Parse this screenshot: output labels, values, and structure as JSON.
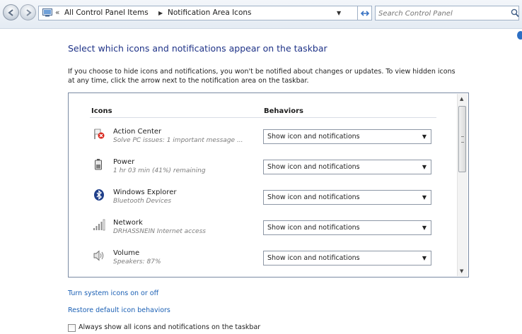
{
  "address_bar": {
    "breadcrumbs": [
      "All Control Panel Items",
      "Notification Area Icons"
    ],
    "search_placeholder": "Search Control Panel"
  },
  "page": {
    "heading": "Select which icons and notifications appear on the taskbar",
    "description": "If you choose to hide icons and notifications, you won't be notified about changes or updates. To view hidden icons at any time, click the arrow next to the notification area on the taskbar."
  },
  "table": {
    "col_icons": "Icons",
    "col_behaviors": "Behaviors",
    "rows": [
      {
        "name": "Action Center",
        "sub": "Solve PC issues: 1 important message ...",
        "behavior": "Show icon and notifications",
        "icon": "action-center-flag-icon"
      },
      {
        "name": "Power",
        "sub": "1 hr 03 min (41%) remaining",
        "behavior": "Show icon and notifications",
        "icon": "battery-icon"
      },
      {
        "name": "Windows Explorer",
        "sub": "Bluetooth Devices",
        "behavior": "Show icon and notifications",
        "icon": "bluetooth-icon"
      },
      {
        "name": "Network",
        "sub": "DRHASSNEIN Internet access",
        "behavior": "Show icon and notifications",
        "icon": "network-signal-icon"
      },
      {
        "name": "Volume",
        "sub": "Speakers: 87%",
        "behavior": "Show icon and notifications",
        "icon": "speaker-icon"
      }
    ]
  },
  "links": {
    "system_icons": "Turn system icons on or off",
    "restore_defaults": "Restore default icon behaviors"
  },
  "checkbox": {
    "label": "Always show all icons and notifications on the taskbar",
    "checked": false
  },
  "colors": {
    "heading": "#1e3287",
    "link": "#1a5fb4"
  }
}
